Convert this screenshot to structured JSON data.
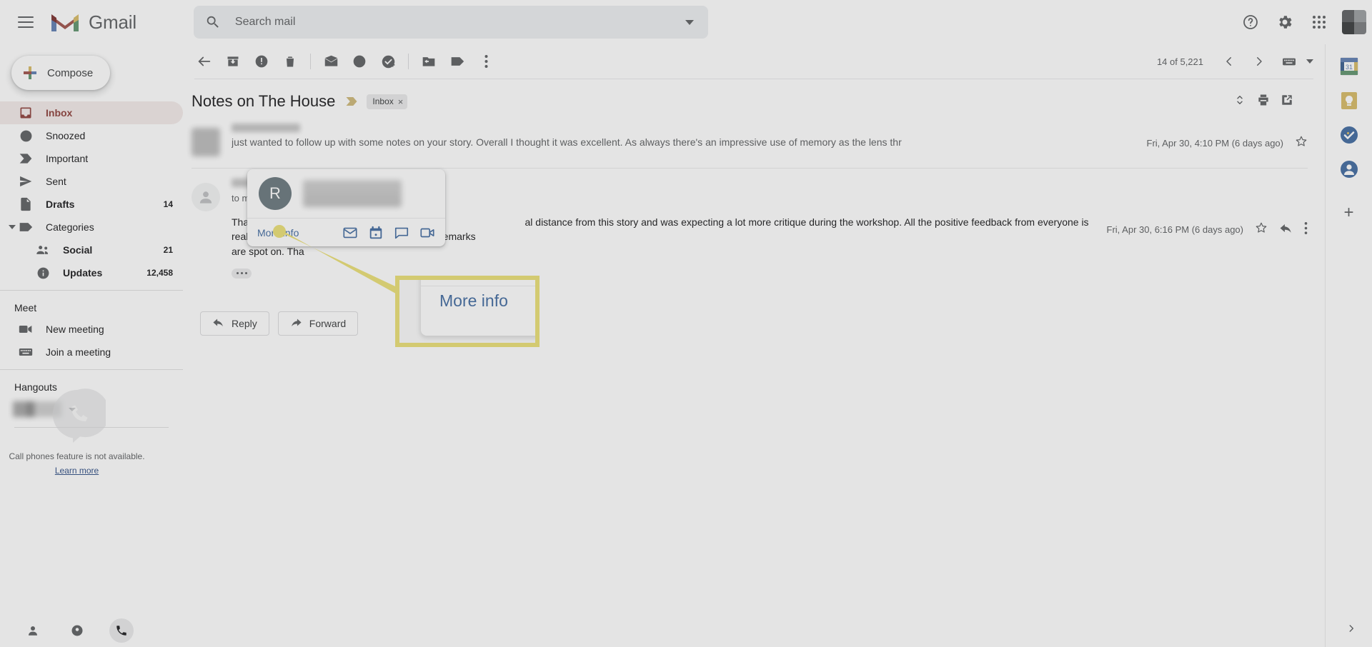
{
  "app": {
    "brand": "Gmail",
    "accent_red": "#d93025",
    "accent_blue": "#1a73e8",
    "highlight_yellow": "#ffe600"
  },
  "topbar": {
    "menu_icon": "hamburger-icon",
    "logo_icon": "gmail-m-logo",
    "brand": "Gmail",
    "search": {
      "placeholder": "Search mail",
      "value": "",
      "icon": "search-icon",
      "options_icon": "chevron-down-icon"
    },
    "help_icon": "help-circle-icon",
    "settings_icon": "gear-icon",
    "apps_icon": "apps-grid-icon",
    "account_avatar": "account-avatar"
  },
  "sidebar": {
    "compose_label": "Compose",
    "items": [
      {
        "label": "Inbox",
        "count": "",
        "icon": "inbox-icon",
        "active": true,
        "bold": true,
        "sub": false
      },
      {
        "label": "Snoozed",
        "count": "",
        "icon": "clock-icon",
        "active": false,
        "bold": false,
        "sub": false
      },
      {
        "label": "Important",
        "count": "",
        "icon": "label-important-icon",
        "active": false,
        "bold": false,
        "sub": false
      },
      {
        "label": "Sent",
        "count": "",
        "icon": "send-icon",
        "active": false,
        "bold": false,
        "sub": false
      },
      {
        "label": "Drafts",
        "count": "14",
        "icon": "draft-icon",
        "active": false,
        "bold": true,
        "sub": false
      },
      {
        "label": "Categories",
        "count": "",
        "icon": "label-icon",
        "active": false,
        "bold": false,
        "sub": false,
        "twisty": true
      },
      {
        "label": "Social",
        "count": "21",
        "icon": "people-icon",
        "active": false,
        "bold": true,
        "sub": true
      },
      {
        "label": "Updates",
        "count": "12,458",
        "icon": "info-icon",
        "active": false,
        "bold": true,
        "sub": true
      }
    ],
    "meet": {
      "heading": "Meet",
      "items": [
        {
          "label": "New meeting",
          "icon": "video-camera-icon"
        },
        {
          "label": "Join a meeting",
          "icon": "keyboard-icon"
        }
      ]
    },
    "hangouts": {
      "heading": "Hangouts",
      "status_caret": "chevron-down-icon"
    },
    "phone": {
      "icon": "phone-bubble-icon",
      "note": "Call phones feature is not available.",
      "link": "Learn more"
    },
    "footer_icons": [
      "contacts-icon",
      "phone-dial-icon",
      "call-icon"
    ]
  },
  "toolbar": {
    "icons": [
      "back-arrow-icon",
      "archive-icon",
      "report-spam-icon",
      "delete-icon",
      "mark-unread-icon",
      "snooze-icon",
      "add-to-tasks-icon",
      "move-to-icon",
      "labels-icon",
      "more-options-icon"
    ],
    "page_count": "14 of 5,221",
    "prev_icon": "chevron-left-icon",
    "next_icon": "chevron-right-icon",
    "input_tools_icon": "keyboard-icon",
    "input_tools_caret": "chevron-down-icon"
  },
  "thread": {
    "subject": "Notes on The House",
    "important_marker_icon": "label-important-icon",
    "label_chip": {
      "text": "Inbox",
      "remove": "×"
    },
    "header_actions": [
      "expand-all-icon",
      "print-icon",
      "open-in-new-window-icon"
    ],
    "messages": [
      {
        "avatar": "blurred-avatar",
        "sender": "",
        "snippet": "just wanted to follow up with some notes on your story. Overall I thought it was excellent. As always there's an impressive use of memory as the lens thr",
        "date": "Fri, Apr 30, 4:10 PM (6 days ago)",
        "star_icon": "star-outline-icon",
        "collapsed": true
      },
      {
        "avatar": "generic-person-avatar",
        "sender": "",
        "to_line": "to me",
        "to_caret": "chevron-down-icon",
        "body_part_1": "Thanks so much",
        "body_part_2": "al distance from this story and was expecting a lot more critique during the workshop. All the positive feedback from everyone is really lifting my spirits. I think your reading and remarks",
        "body_part_3": "are spot on. Tha",
        "date": "Fri, Apr 30, 6:16 PM (6 days ago)",
        "star_icon": "star-outline-icon",
        "reply_icon": "reply-arrow-icon",
        "more_icon": "more-options-icon",
        "trimmed_icon": "show-trimmed-content-icon",
        "collapsed": false
      }
    ],
    "reply_label": "Reply",
    "reply_icon": "reply-arrow-icon",
    "forward_label": "Forward",
    "forward_icon": "forward-arrow-icon"
  },
  "hovercard": {
    "avatar_initial": "R",
    "name": "",
    "more_info_label": "More info",
    "actions": [
      {
        "icon": "email-icon"
      },
      {
        "icon": "calendar-icon"
      },
      {
        "icon": "chat-bubble-icon"
      },
      {
        "icon": "video-call-icon"
      }
    ]
  },
  "callout": {
    "magnified_label": "More info",
    "border_color": "#ffe600"
  },
  "rail": {
    "apps": [
      "google-calendar-icon",
      "google-keep-icon",
      "google-tasks-icon",
      "google-contacts-icon"
    ],
    "add_label": "+",
    "expand_icon": "chevron-right-icon"
  }
}
